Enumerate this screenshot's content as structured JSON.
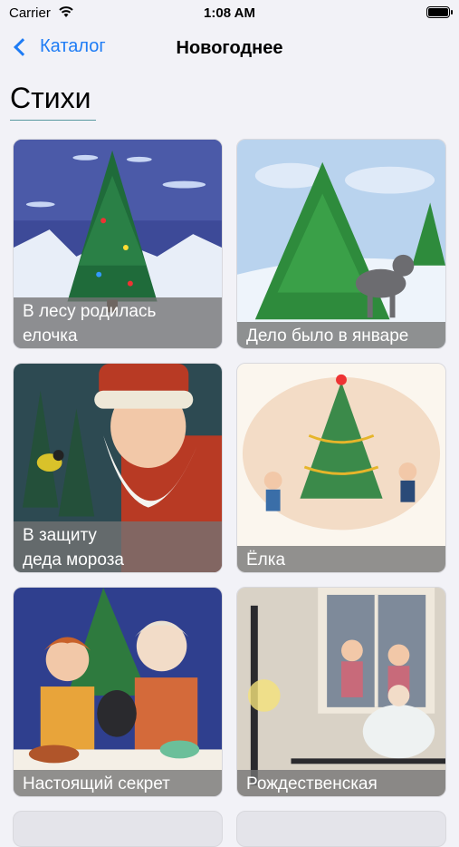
{
  "status": {
    "carrier": "Carrier",
    "time": "1:08 AM"
  },
  "nav": {
    "back_label": "Каталог",
    "title": "Новогоднее"
  },
  "section": {
    "title": "Стихи"
  },
  "cards": [
    {
      "title_line1": "В лесу родилась",
      "title_line2": "елочка",
      "image": "snowy-fir-tree-night"
    },
    {
      "title_line1": "Дело было в январе",
      "title_line2": "",
      "image": "wolf-under-fir-tree"
    },
    {
      "title_line1": "В защиту",
      "title_line2": "деда мороза",
      "image": "santa-with-bird"
    },
    {
      "title_line1": "Ёлка",
      "title_line2": "",
      "image": "kids-dancing-around-tree"
    },
    {
      "title_line1": "Настоящий секрет",
      "title_line2": "",
      "image": "family-with-cat-at-table"
    },
    {
      "title_line1": "Рождественская",
      "title_line2": "",
      "image": "angel-by-window"
    }
  ]
}
